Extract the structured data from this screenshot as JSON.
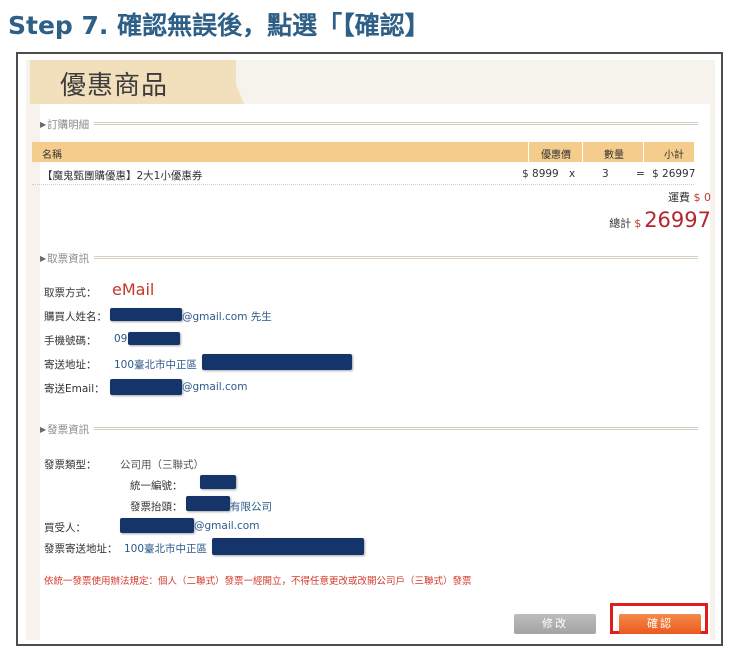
{
  "step": {
    "heading": "Step 7. 確認無誤後，點選「【確認】"
  },
  "page": {
    "tab_title": "優惠商品"
  },
  "order": {
    "section_title": "訂購明細",
    "columns": [
      "名稱",
      "優惠價",
      "數量",
      "小計"
    ],
    "item": {
      "name": "【魔鬼甄團購優惠】2大1小優惠券",
      "price": "$ 8999",
      "times": "x",
      "qty": "3",
      "equals": "=",
      "subtotal": "$ 26997"
    },
    "shipping_label": "運費",
    "shipping_value": "$ 0",
    "total_label": "總計",
    "total_currency": "$",
    "total_value": "26997"
  },
  "ticket": {
    "section_title": "取票資訊",
    "method_label": "取票方式：",
    "method_value": "eMail",
    "buyer_label": "購買人姓名：",
    "buyer_email_suffix": "@gmail.com 先生",
    "phone_label": "手機號碼：",
    "phone_prefix": "09",
    "address_label": "寄送地址：",
    "address_prefix": "100臺北市中正區",
    "email_label": "寄送Email：",
    "email_suffix": "@gmail.com"
  },
  "invoice": {
    "section_title": "發票資訊",
    "type_label": "發票類型：",
    "type_value": "公司用（三聯式）",
    "tax_id_label": "統一編號：",
    "title_label": "發票抬頭：",
    "title_suffix": "有限公司",
    "recipient_label": "買受人：",
    "recipient_suffix": "@gmail.com",
    "address_label": "發票寄送地址：",
    "address_prefix": "100臺北市中正區",
    "notice": "依統一發票使用辦法規定：個人（二聯式）發票一經開立，不得任意更改或改開公司戶（三聯式）發票"
  },
  "buttons": {
    "modify": "修改",
    "confirm": "確認"
  },
  "colors": {
    "heading": "#2e5f87",
    "table_header": "#f4cd8d",
    "accent_red": "#c0392b",
    "confirm_button": "#ea5a1e",
    "highlight_box": "#e11c1c",
    "redaction": "#14346a"
  }
}
